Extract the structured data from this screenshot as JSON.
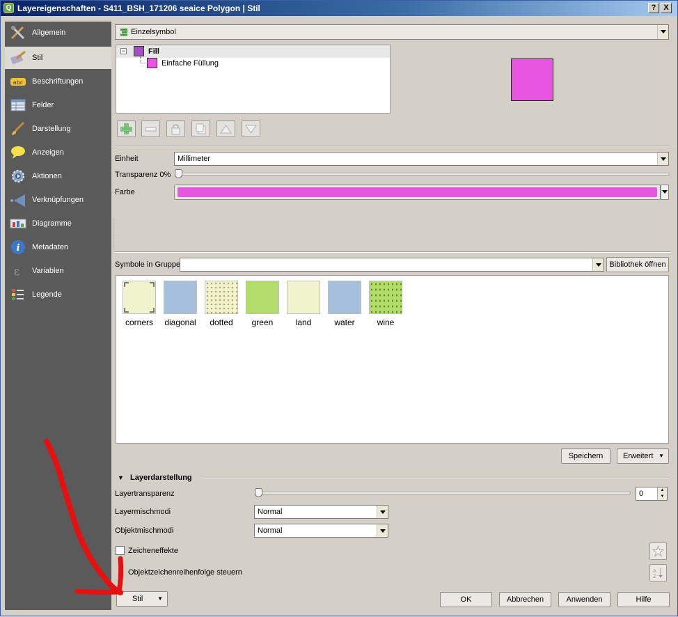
{
  "window": {
    "title": "Layereigenschaften - S411_BSH_171206 seaice Polygon | Stil",
    "help_label": "?",
    "close_label": "X"
  },
  "sidebar": {
    "items": [
      {
        "label": "Allgemein",
        "icon": "tools-icon"
      },
      {
        "label": "Stil",
        "icon": "paintbrush-icon"
      },
      {
        "label": "Beschriftungen",
        "icon": "abc-label-icon"
      },
      {
        "label": "Felder",
        "icon": "table-icon"
      },
      {
        "label": "Darstellung",
        "icon": "brush-icon"
      },
      {
        "label": "Anzeigen",
        "icon": "speech-bubble-icon"
      },
      {
        "label": "Aktionen",
        "icon": "gear-icon"
      },
      {
        "label": "Verknüpfungen",
        "icon": "join-icon"
      },
      {
        "label": "Diagramme",
        "icon": "diagram-icon"
      },
      {
        "label": "Metadaten",
        "icon": "info-icon"
      },
      {
        "label": "Variablen",
        "icon": "epsilon-icon"
      },
      {
        "label": "Legende",
        "icon": "legend-icon"
      }
    ]
  },
  "renderer": {
    "value": "Einzelsymbol"
  },
  "symbol_tree": {
    "root_label": "Fill",
    "child_label": "Einfache Füllung",
    "root_color": "#a64ec4",
    "child_color": "#e855e0"
  },
  "preview": {
    "color": "#e855e0"
  },
  "props": {
    "unit_label": "Einheit",
    "unit_value": "Millimeter",
    "transparency_label": "Transparenz 0%",
    "transparency_value": 0,
    "color_label": "Farbe",
    "color_value": "#e855e0"
  },
  "library": {
    "group_label": "Symbole in Gruppe",
    "group_value": "",
    "open_button": "Bibliothek öffnen",
    "symbols": [
      {
        "name": "corners",
        "color": "#f0f3cc",
        "pattern": "corners"
      },
      {
        "name": "diagonal",
        "color": "#a6bfdd",
        "pattern": "plain"
      },
      {
        "name": "dotted",
        "color": "#f0f3cc",
        "pattern": "dots"
      },
      {
        "name": "green",
        "color": "#b3dd6a",
        "pattern": "plain"
      },
      {
        "name": "land",
        "color": "#f0f3cc",
        "pattern": "plain"
      },
      {
        "name": "water",
        "color": "#a6bfdd",
        "pattern": "plain"
      },
      {
        "name": "wine",
        "color": "#b3dd6a",
        "pattern": "wine"
      }
    ],
    "save_button": "Speichern",
    "advanced_button": "Erweitert"
  },
  "layer_render": {
    "section_title": "Layerdarstellung",
    "transparency_label": "Layertransparenz",
    "transparency_value": "0",
    "layer_blend_label": "Layermischmodi",
    "layer_blend_value": "Normal",
    "feature_blend_label": "Objektmischmodi",
    "feature_blend_value": "Normal",
    "effects_label": "Zeicheneffekte",
    "order_label": "Objektzeichenreihenfolge steuern"
  },
  "footer": {
    "style_button": "Stil",
    "ok_button": "OK",
    "cancel_button": "Abbrechen",
    "apply_button": "Anwenden",
    "help_button": "Hilfe"
  }
}
